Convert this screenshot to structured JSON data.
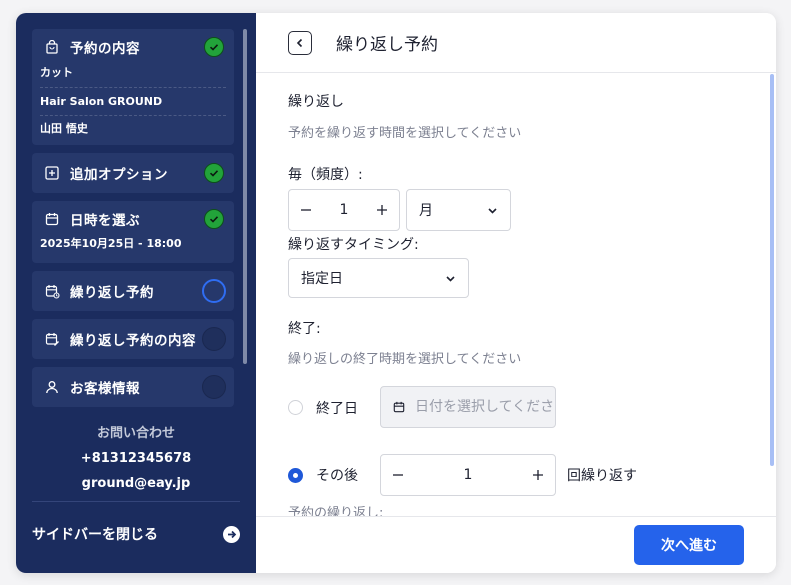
{
  "sidebar": {
    "steps": [
      {
        "title": "予約の内容",
        "status": "done",
        "details": [
          "カット",
          "Hair Salon GROUND",
          "山田 悟史"
        ]
      },
      {
        "title": "追加オプション",
        "status": "done"
      },
      {
        "title": "日時を選ぶ",
        "status": "done",
        "details": [
          "2025年10月25日 - 18:00"
        ]
      },
      {
        "title": "繰り返し予約",
        "status": "active"
      },
      {
        "title": "繰り返し予約の内容",
        "status": "todo"
      },
      {
        "title": "お客様情報",
        "status": "todo"
      }
    ],
    "contact": {
      "label": "お問い合わせ",
      "phone": "+81312345678",
      "email": "ground@eay.jp"
    },
    "close_label": "サイドバーを閉じる"
  },
  "header": {
    "title": "繰り返し予約"
  },
  "form": {
    "section_title": "繰り返し",
    "section_hint": "予約を繰り返す時間を選択してください",
    "frequency_label": "毎（頻度）:",
    "frequency_value": "1",
    "frequency_unit": "月",
    "timing_label": "繰り返すタイミング:",
    "timing_value": "指定日",
    "end_title": "終了:",
    "end_hint": "繰り返しの終了時期を選択してください",
    "end_date_label": "終了日",
    "end_date_placeholder": "日付を選択してください",
    "after_label": "その後",
    "after_value": "1",
    "after_suffix": "回繰り返す",
    "cut_label": "予約の繰り返し:"
  },
  "footer": {
    "next_label": "次へ進む"
  },
  "colors": {
    "sidebar_bg": "#1b2c5e",
    "card_bg": "#26386b",
    "done": "#22a33a",
    "accent": "#2563eb"
  }
}
